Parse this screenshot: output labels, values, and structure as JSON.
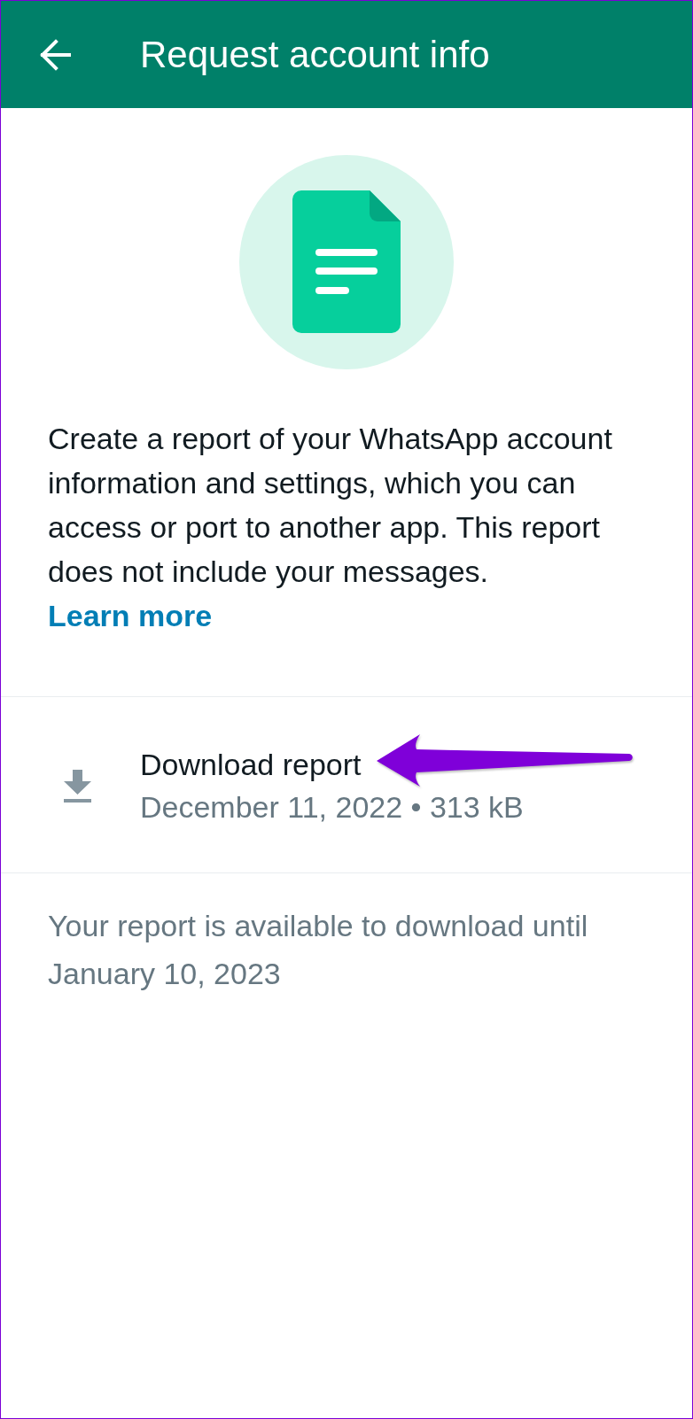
{
  "app_bar": {
    "title": "Request account info"
  },
  "description": {
    "text": "Create a report of your WhatsApp account information and settings, which you can access or port to another app. This report does not include your messages.",
    "link": "Learn more"
  },
  "report": {
    "title": "Download report",
    "details": "December 11, 2022 • 313 kB"
  },
  "availability_note": "Your report is available to download until January 10, 2023"
}
